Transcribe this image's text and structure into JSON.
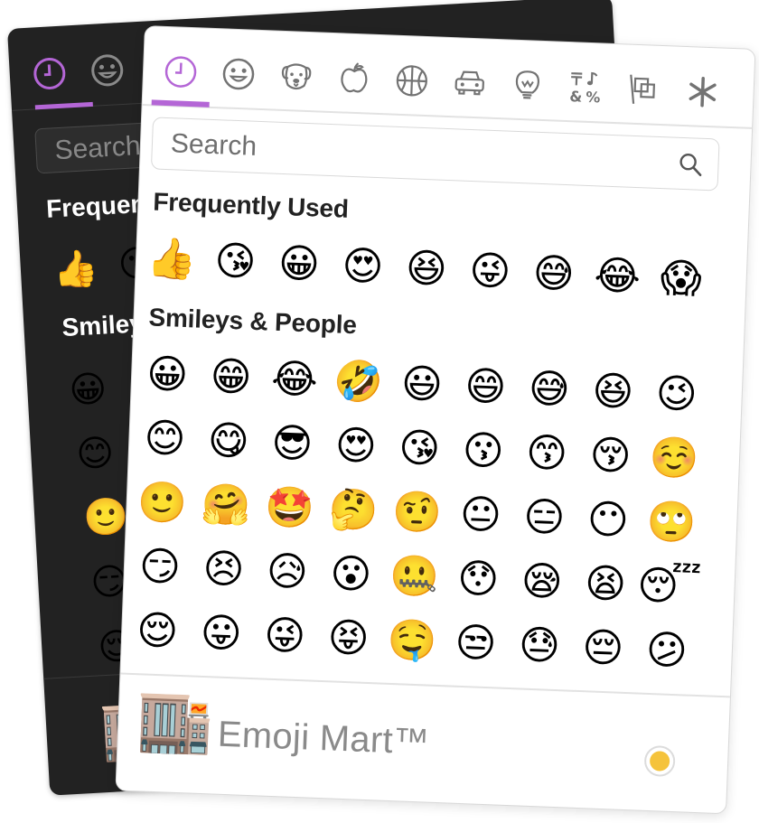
{
  "accent_color": "#b466d6",
  "skin_tone_color": "#f5c33b",
  "dark_panel": {
    "search_placeholder": "Search",
    "frequent_label": "Frequen",
    "smileys_label": "Smileys",
    "frequent_emojis": [
      "👍",
      "😘"
    ],
    "smiley_column": [
      "😀",
      "😊",
      "🙂",
      "😏",
      "😌"
    ],
    "footer_emoji": "🏬"
  },
  "tabs": [
    {
      "name": "recent",
      "icon": "clock-icon",
      "active": true
    },
    {
      "name": "smileys-people",
      "icon": "smiley-icon",
      "active": false
    },
    {
      "name": "animals-nature",
      "icon": "dog-icon",
      "active": false
    },
    {
      "name": "food-drink",
      "icon": "apple-icon",
      "active": false
    },
    {
      "name": "activity",
      "icon": "basketball-icon",
      "active": false
    },
    {
      "name": "travel-places",
      "icon": "car-icon",
      "active": false
    },
    {
      "name": "objects",
      "icon": "lightbulb-icon",
      "active": false
    },
    {
      "name": "symbols",
      "icon": "symbols-icon",
      "active": false
    },
    {
      "name": "flags",
      "icon": "flag-icon",
      "active": false
    },
    {
      "name": "custom",
      "icon": "asterisk-icon",
      "active": false
    }
  ],
  "search": {
    "placeholder": "Search",
    "value": ""
  },
  "categories": [
    {
      "label": "Frequently Used",
      "emojis": [
        "👍",
        "😘",
        "😀",
        "😍",
        "😆",
        "😜",
        "😅",
        "😂",
        "😱"
      ]
    },
    {
      "label": "Smileys & People",
      "emojis": [
        "😀",
        "😁",
        "😂",
        "🤣",
        "😃",
        "😄",
        "😅",
        "😆",
        "😉",
        "😊",
        "😋",
        "😎",
        "😍",
        "😘",
        "😗",
        "😙",
        "😚",
        "☺️",
        "🙂",
        "🤗",
        "🤩",
        "🤔",
        "🤨",
        "😐",
        "😑",
        "😶",
        "🙄",
        "😏",
        "😣",
        "😥",
        "😮",
        "🤐",
        "😯",
        "😪",
        "😫",
        "😴",
        "😌",
        "😛",
        "😜",
        "😝",
        "🤤",
        "😒",
        "😓",
        "😔",
        "😕"
      ]
    }
  ],
  "footer": {
    "logo_emoji": "🏬",
    "title": "Emoji Mart™"
  }
}
